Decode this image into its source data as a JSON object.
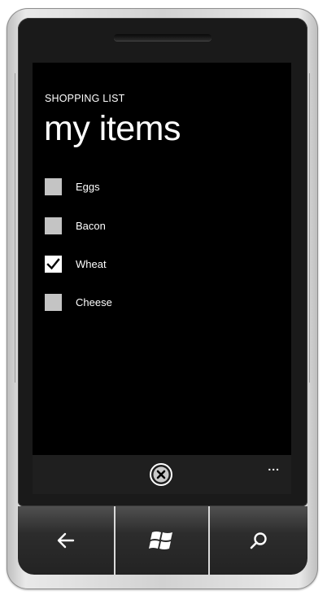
{
  "app": {
    "title": "SHOPPING LIST",
    "page_title": "my items"
  },
  "items": [
    {
      "label": "Eggs",
      "checked": false
    },
    {
      "label": "Bacon",
      "checked": false
    },
    {
      "label": "Wheat",
      "checked": true
    },
    {
      "label": "Cheese",
      "checked": false
    }
  ],
  "appbar": {
    "button_icon": "cancel-circle-icon",
    "more": "..."
  },
  "hardware_buttons": [
    {
      "name": "back",
      "icon": "back-arrow-icon"
    },
    {
      "name": "start",
      "icon": "windows-logo-icon"
    },
    {
      "name": "search",
      "icon": "search-icon"
    }
  ],
  "colors": {
    "screen_bg": "#000000",
    "text": "#ffffff",
    "checkbox": "#c4c4c4",
    "appbar_bg": "#1f1f1f"
  }
}
